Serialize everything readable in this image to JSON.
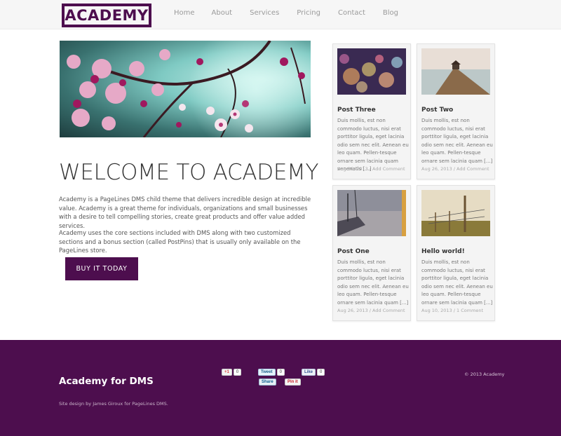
{
  "header": {
    "logo": "ACADEMY",
    "nav": [
      "Home",
      "About",
      "Services",
      "Pricing",
      "Contact",
      "Blog"
    ]
  },
  "main": {
    "title": "WELCOME TO ACADEMY",
    "paragraph1": "Academy is a PageLines DMS child theme that delivers incredible design at incredible value. Academy is a great theme for individuals, organizations and small businesses with a desire to tell compelling stories, create great products and offer value added services.",
    "paragraph2": "Academy uses the core sections included with DMS along with two customized sections and a bonus section (called PostPins) that is usually only available on the PageLines store.",
    "cta": "BUY IT TODAY"
  },
  "posts": [
    {
      "title": "Post Three",
      "excerpt": "Duis mollis, est non commodo luctus, nisi erat porttitor ligula, eget lacinia odio sem nec elit. Aenean eu leo quam. Pellen-tesque ornare sem lacinia quam venenatis [...]",
      "date": "Aug 26, 2013",
      "comment": "Add Comment"
    },
    {
      "title": "Post Two",
      "excerpt": "Duis mollis, est non commodo luctus, nisi erat porttitor ligula, eget lacinia odio sem nec elit. Aenean eu leo quam. Pellen-tesque ornare sem lacinia quam [...]",
      "date": "Aug 26, 2013",
      "comment": "Add Comment"
    },
    {
      "title": "Post One",
      "excerpt": "Duis mollis, est non commodo luctus, nisi erat porttitor ligula, eget lacinia odio sem nec elit. Aenean eu leo quam. Pellen-tesque ornare sem lacinia quam [...]",
      "date": "Aug 26, 2013",
      "comment": "Add Comment"
    },
    {
      "title": "Hello world!",
      "excerpt": "Duis mollis, est non commodo luctus, nisi erat porttitor ligula, eget lacinia odio sem nec elit. Aenean eu leo quam. Pellen-tesque ornare sem lacinia quam [...]",
      "date": "Aug 10, 2013",
      "comment": "1 Comment"
    }
  ],
  "meta_separator": " / ",
  "footer": {
    "title": "Academy for DMS",
    "credit": "Site design by James Giroux for PageLines DMS.",
    "copyright": "© 2013 Academy",
    "share": {
      "plus_label": "+1",
      "plus_count": "0",
      "tweet_label": "Tweet",
      "tweet_count": "0",
      "like_label": "Like",
      "like_count": "0",
      "linkedin_label": "Share",
      "pin_label": "Pin it"
    }
  },
  "colors": {
    "brand": "#4d0e4e",
    "header_bg": "#f6f6f6",
    "card_bg": "#f4f4f4"
  }
}
